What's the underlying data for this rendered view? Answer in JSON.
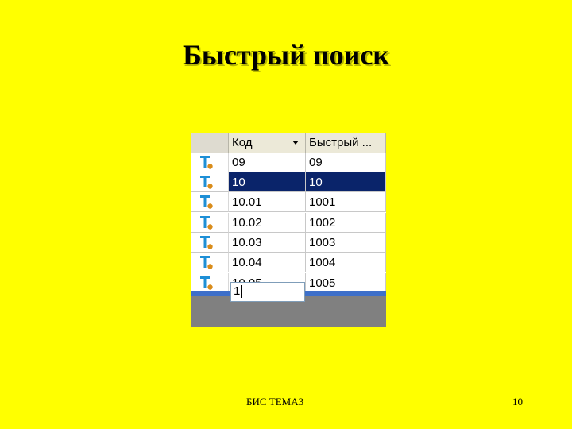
{
  "slide": {
    "title": "Быстрый поиск",
    "footer_text": "БИС ТЕМА3",
    "page_number": "10"
  },
  "grid": {
    "columns": [
      "",
      "Код",
      "Быстрый ..."
    ],
    "sort_icon": "triangle-down-icon",
    "row_icon": "t-icon",
    "selected_row_index": 1,
    "rows": [
      {
        "code": "09",
        "quick": "09"
      },
      {
        "code": "10",
        "quick": "10"
      },
      {
        "code": "10.01",
        "quick": "1001"
      },
      {
        "code": "10.02",
        "quick": "1002"
      },
      {
        "code": "10.03",
        "quick": "1003"
      },
      {
        "code": "10.04",
        "quick": "1004"
      },
      {
        "code": "10.05",
        "quick": "1005"
      }
    ],
    "search_value": "1"
  },
  "colors": {
    "background": "#ffff00",
    "selection": "#0a246a",
    "icon_t": "#1e8fd6",
    "icon_dot": "#d98c1a"
  }
}
